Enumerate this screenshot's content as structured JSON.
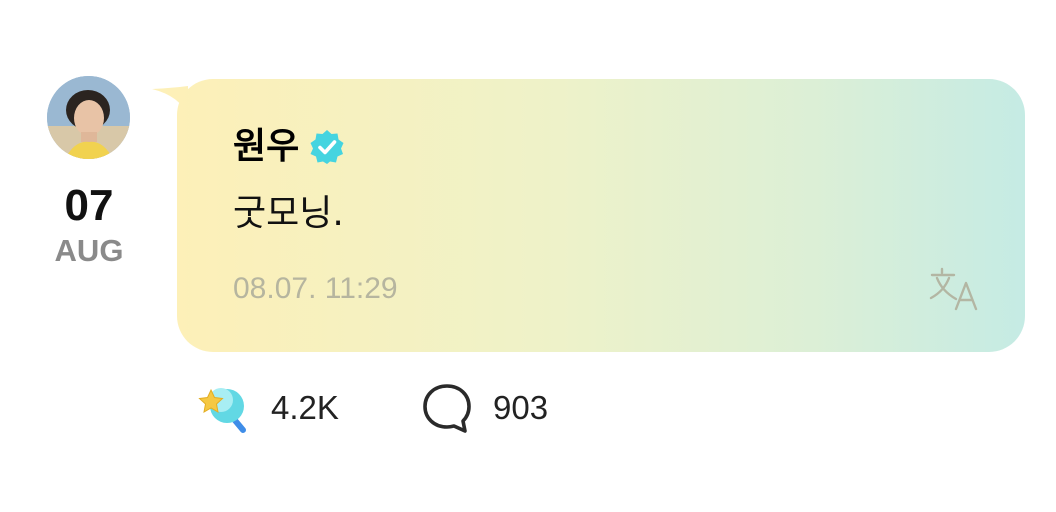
{
  "post": {
    "date_day": "07",
    "date_month": "AUG",
    "author_name": "원우",
    "message": "굿모닝.",
    "timestamp": "08.07. 11:29"
  },
  "reactions": {
    "likes": "4.2K",
    "comments": "903"
  },
  "icons": {
    "verified": "verified-badge-icon",
    "translate": "translate-icon",
    "like": "star-moon-lightstick-icon",
    "comment": "speech-bubble-icon"
  },
  "colors": {
    "bubble_gradient_start": "#fdf0b8",
    "bubble_gradient_end": "#c5ebe4",
    "verified": "#45d4e0",
    "timestamp": "#b6b59f",
    "month": "#8a8a8a"
  }
}
